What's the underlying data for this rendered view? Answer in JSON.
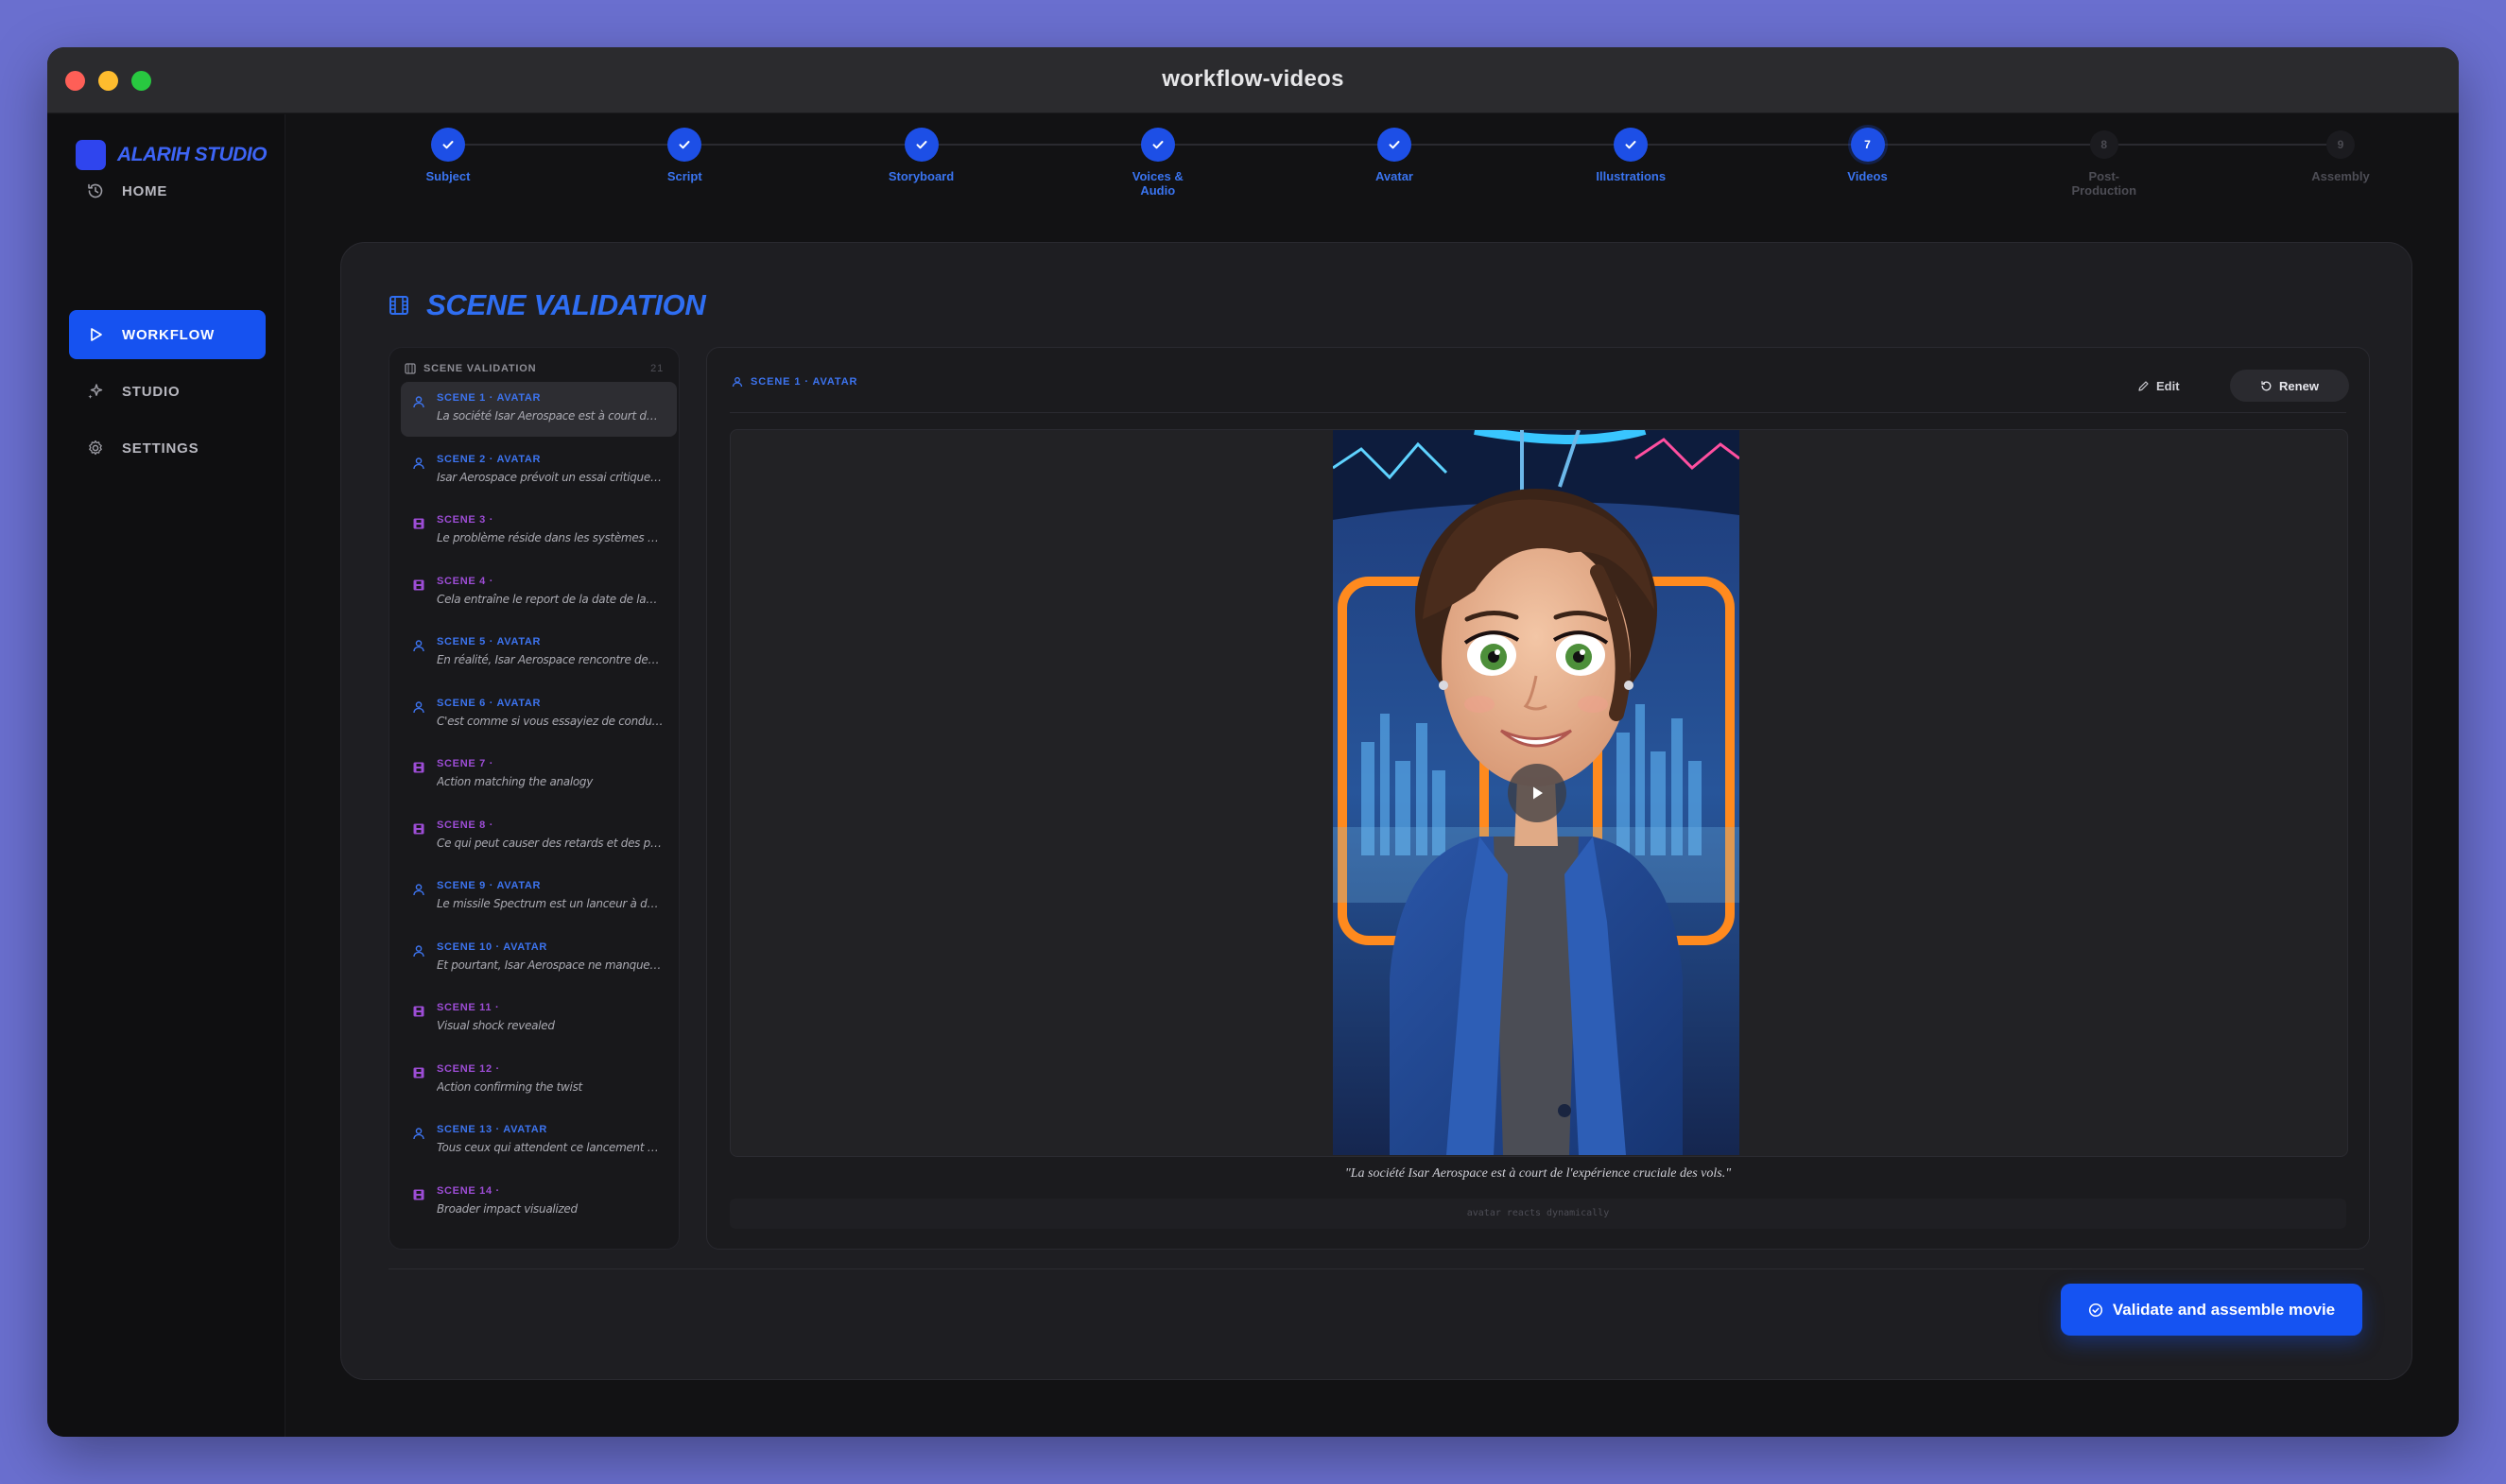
{
  "window": {
    "title": "workflow-videos"
  },
  "sidebar": {
    "brand": "ALARIH STUDIO",
    "items": [
      {
        "label": "HOME",
        "icon": "history-icon",
        "active": false
      },
      {
        "label": "WORKFLOW",
        "icon": "play-icon",
        "active": true
      },
      {
        "label": "STUDIO",
        "icon": "sparkles-icon",
        "active": false
      },
      {
        "label": "SETTINGS",
        "icon": "gear-icon",
        "active": false
      }
    ]
  },
  "stepper": {
    "steps": [
      {
        "number": "1",
        "label": "Subject",
        "status": "done"
      },
      {
        "number": "2",
        "label": "Script",
        "status": "done"
      },
      {
        "number": "3",
        "label": "Storyboard",
        "status": "done"
      },
      {
        "number": "4",
        "label": "Voices &\nAudio",
        "status": "done"
      },
      {
        "number": "5",
        "label": "Avatar",
        "status": "done"
      },
      {
        "number": "6",
        "label": "Illustrations",
        "status": "done"
      },
      {
        "number": "7",
        "label": "Videos",
        "status": "current"
      },
      {
        "number": "8",
        "label": "Post-\nProduction",
        "status": "pending"
      },
      {
        "number": "9",
        "label": "Assembly",
        "status": "pending"
      }
    ]
  },
  "main": {
    "title": "SCENE VALIDATION",
    "scene_list": {
      "header": "SCENE VALIDATION",
      "count": "21",
      "items": [
        {
          "title": "SCENE 1 · AVATAR",
          "text": "La société Isar Aerospace est à court de l'ex...",
          "type": "avatar",
          "active": true
        },
        {
          "title": "SCENE 2 · AVATAR",
          "text": "Isar Aerospace prévoit un essai critique de ...",
          "type": "avatar",
          "active": false
        },
        {
          "title": "SCENE 3 ·",
          "text": "Le problème réside dans les systèmes de flu...",
          "type": "illustration",
          "active": false
        },
        {
          "title": "SCENE 4 ·",
          "text": "Cela entraîne le report de la date de lance...",
          "type": "illustration",
          "active": false
        },
        {
          "title": "SCENE 5 · AVATAR",
          "text": "En réalité, Isar Aerospace rencontre des pro...",
          "type": "avatar",
          "active": false
        },
        {
          "title": "SCENE 6 · AVATAR",
          "text": "C'est comme si vous essayiez de conduire u...",
          "type": "avatar",
          "active": false
        },
        {
          "title": "SCENE 7 ·",
          "text": "Action matching the analogy",
          "type": "illustration",
          "active": false
        },
        {
          "title": "SCENE 8 ·",
          "text": "Ce qui peut causer des retards et des probl...",
          "type": "illustration",
          "active": false
        },
        {
          "title": "SCENE 9 · AVATAR",
          "text": "Le missile Spectrum est un lanceur à deux é...",
          "type": "avatar",
          "active": false
        },
        {
          "title": "SCENE 10 · AVATAR",
          "text": "Et pourtant, Isar Aerospace ne manque pas...",
          "type": "avatar",
          "active": false
        },
        {
          "title": "SCENE 11 ·",
          "text": "Visual shock revealed",
          "type": "illustration",
          "active": false
        },
        {
          "title": "SCENE 12 ·",
          "text": "Action confirming the twist",
          "type": "illustration",
          "active": false
        },
        {
          "title": "SCENE 13 · AVATAR",
          "text": "Tous ceux qui attendent ce lancement pour ...",
          "type": "avatar",
          "active": false
        },
        {
          "title": "SCENE 14 ·",
          "text": "Broader impact visualized",
          "type": "illustration",
          "active": false
        }
      ]
    },
    "viewer": {
      "title": "SCENE 1 · AVATAR",
      "edit_label": "Edit",
      "renew_label": "Renew",
      "caption": "\"La société Isar Aerospace est à court de l'expérience cruciale des vols.\"",
      "hint": "avatar reacts dynamically"
    },
    "validate_label": "Validate and assemble movie"
  },
  "colors": {
    "accent": "#1553f2",
    "avatar_scene": "#3d74f0",
    "illustration_scene": "#9d4dd6",
    "background": "#121214"
  }
}
